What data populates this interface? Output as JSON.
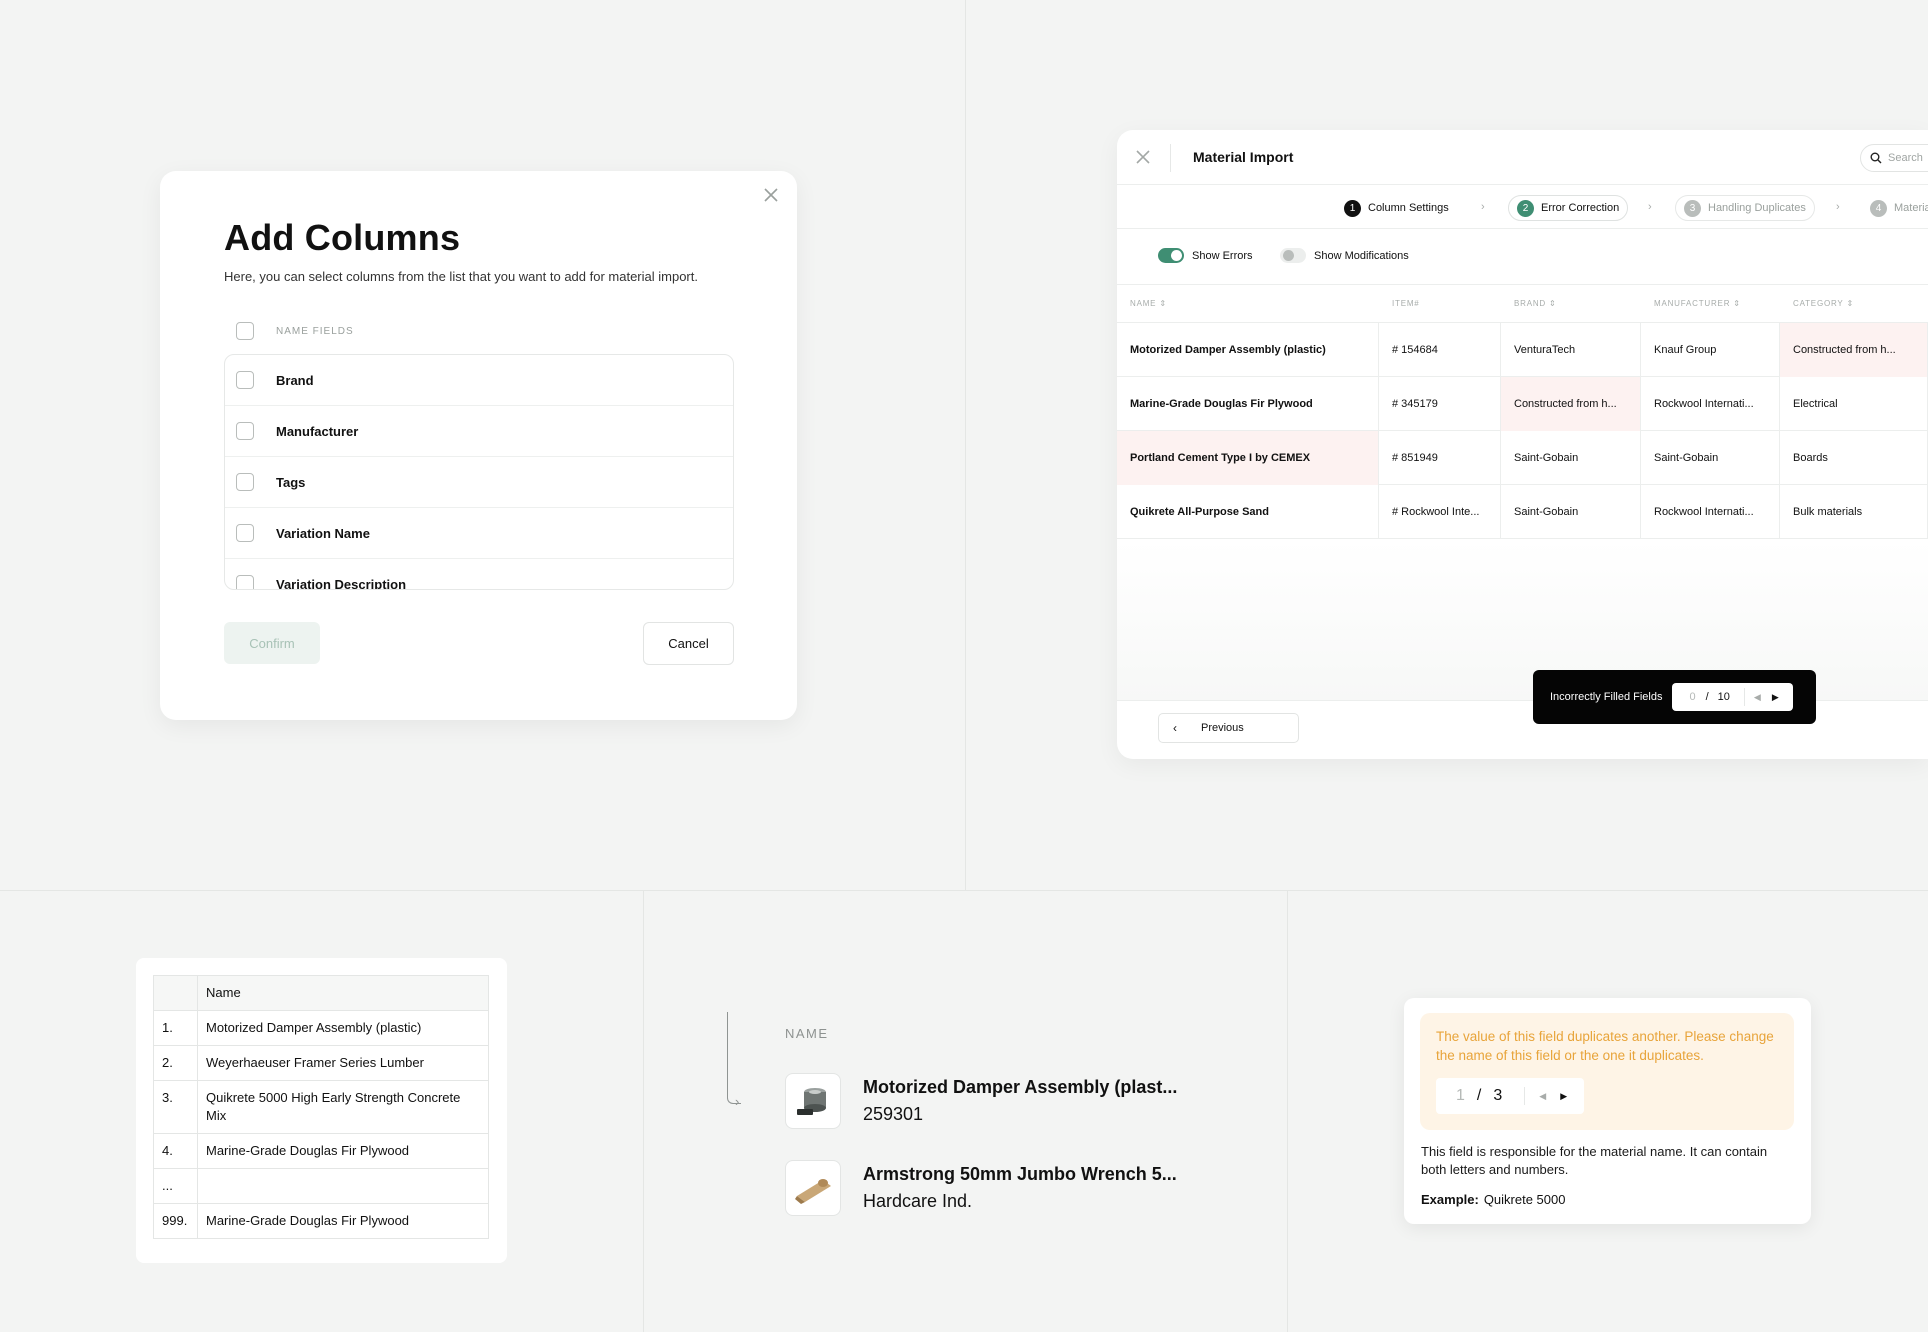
{
  "add_columns": {
    "title": "Add Columns",
    "description": "Here, you can select columns from the list that you want to add for material import.",
    "header_label": "NAME FIELDS",
    "items": [
      "Brand",
      "Manufacturer",
      "Tags",
      "Variation Name",
      "Variation Description"
    ],
    "confirm_label": "Confirm",
    "cancel_label": "Cancel"
  },
  "material_import": {
    "title": "Material Import",
    "search_placeholder": "Search",
    "steps": [
      {
        "num": "1",
        "label": "Column Settings"
      },
      {
        "num": "2",
        "label": "Error Correction"
      },
      {
        "num": "3",
        "label": "Handling Duplicates"
      },
      {
        "num": "4",
        "label": "Materials"
      }
    ],
    "toggles": [
      {
        "label": "Show Errors",
        "on": true
      },
      {
        "label": "Show Modifications",
        "on": false
      }
    ],
    "columns": [
      "NAME",
      "ITEM#",
      "BRAND",
      "MANUFACTURER",
      "CATEGORY"
    ],
    "rows": [
      {
        "name": "Motorized Damper Assembly (plastic)",
        "item": "# 154684",
        "brand": "VenturaTech",
        "manufacturer": "Knauf Group",
        "category": "Constructed from h..."
      },
      {
        "name": "Marine-Grade Douglas Fir Plywood",
        "item": "# 345179",
        "brand": "Constructed from h...",
        "manufacturer": "Rockwool Internati...",
        "category": "Electrical"
      },
      {
        "name": "Portland Cement Type I by CEMEX",
        "item": "# 851949",
        "brand": "Saint-Gobain",
        "manufacturer": "Saint-Gobain",
        "category": "Boards"
      },
      {
        "name": "Quikrete All-Purpose Sand",
        "item": "# Rockwool Inte...",
        "brand": "Saint-Gobain",
        "manufacturer": "Rockwool Internati...",
        "category": "Bulk materials"
      }
    ],
    "previous_label": "Previous",
    "error_bar": {
      "label": "Incorrectly Filled Fields",
      "current": "0",
      "sep": "/",
      "total": "10"
    }
  },
  "name_list": {
    "header": "Name",
    "rows": [
      {
        "n": "1.",
        "name": "Motorized Damper Assembly (plastic)"
      },
      {
        "n": "2.",
        "name": "Weyerhaeuser Framer Series Lumber"
      },
      {
        "n": "3.",
        "name": "Quikrete 5000 High Early Strength Concrete Mix"
      },
      {
        "n": "4.",
        "name": "Marine-Grade Douglas Fir Plywood"
      },
      {
        "n": "...",
        "name": ""
      },
      {
        "n": "999.",
        "name": "Marine-Grade Douglas Fir Plywood"
      }
    ]
  },
  "name_cards": {
    "label": "NAME",
    "cards": [
      {
        "title": "Motorized Damper Assembly (plast...",
        "sub": "259301"
      },
      {
        "title": "Armstrong 50mm Jumbo Wrench 5...",
        "sub": "Hardcare Ind."
      }
    ]
  },
  "duplicate_tip": {
    "message": "The value of this field duplicates another. Please change the name of this field or the one it duplicates.",
    "current": "1",
    "sep": "/",
    "total": "3",
    "body": "This field is responsible for the material name. It can contain both letters and numbers.",
    "example_label": "Example:",
    "example_value": "Quikrete 5000"
  },
  "colors": {
    "accent": "#3f8e73",
    "error_bg": "#fdf2f1",
    "warn_text": "#e8a43a",
    "warn_bg": "#fef4e6"
  }
}
